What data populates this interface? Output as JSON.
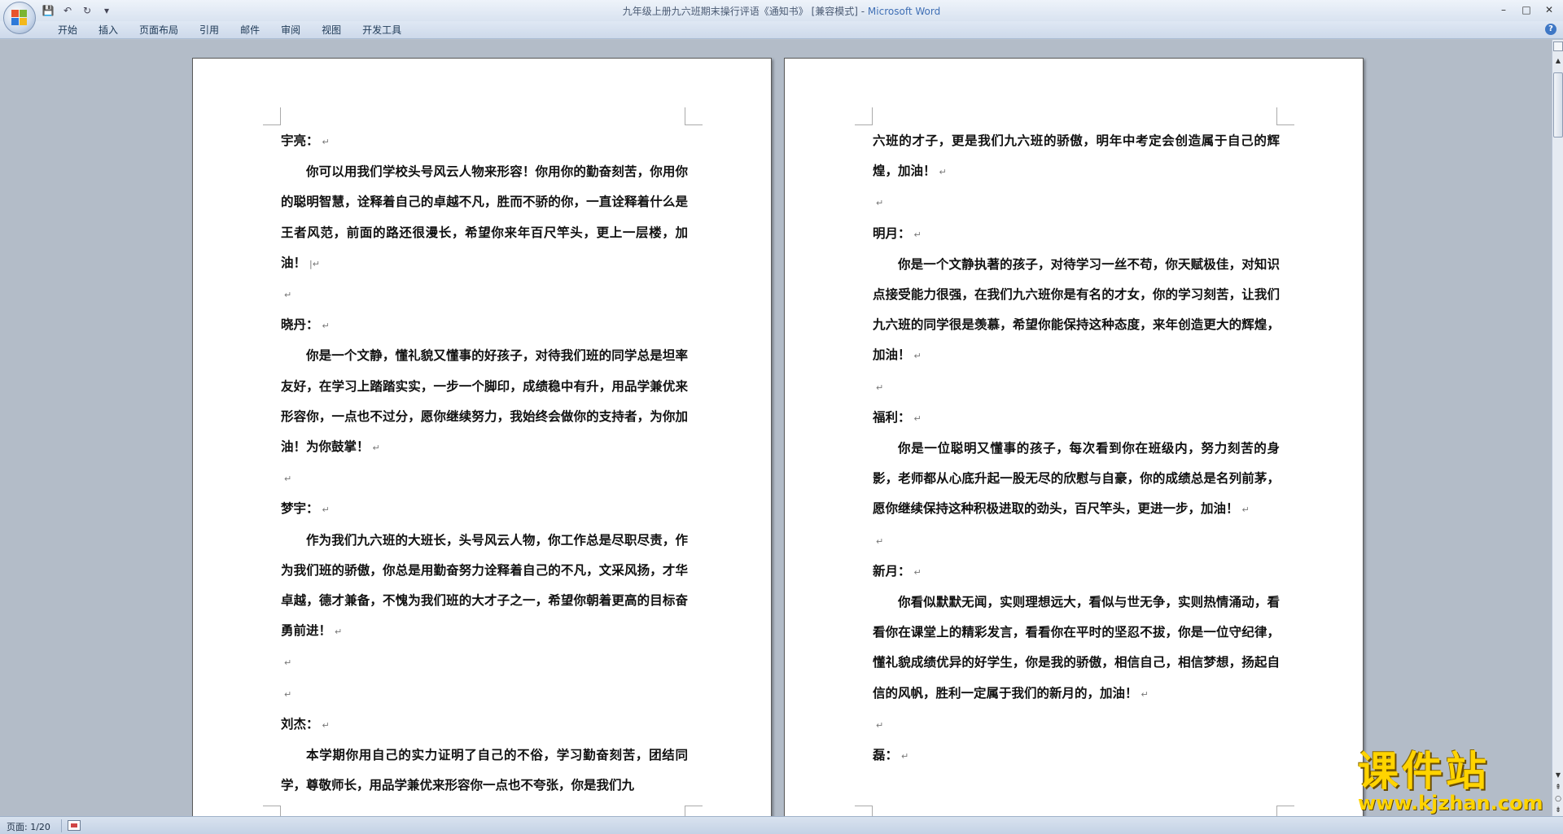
{
  "window": {
    "title_doc": "九年级上册九六班期末操行评语《通知书》 [兼容模式] - ",
    "title_app": "Microsoft Word"
  },
  "qat": {
    "save_icon": "💾",
    "undo_icon": "↶",
    "redo_icon": "↻",
    "customize_icon": "▾"
  },
  "window_controls": {
    "minimize": "–",
    "maximize": "□",
    "close": "✕"
  },
  "ribbon": {
    "tabs": [
      "开始",
      "插入",
      "页面布局",
      "引用",
      "邮件",
      "审阅",
      "视图",
      "开发工具"
    ],
    "help_label": "?"
  },
  "pages": [
    {
      "paragraphs": [
        {
          "text": "宇亮：",
          "indent": false,
          "mark": "↵"
        },
        {
          "text": "你可以用我们学校头号风云人物来形容！你用你的勤奋刻苦，你用你的聪明智慧，诠释着自己的卓越不凡，胜而不骄的你，一直诠释着什么是王者风范，前面的路还很漫长，希望你来年百尺竿头，更上一层楼，加油！",
          "indent": true,
          "mark": "|↵"
        },
        {
          "text": "",
          "indent": false,
          "mark": "↵"
        },
        {
          "text": "晓丹：",
          "indent": false,
          "mark": "↵"
        },
        {
          "text": "你是一个文静，懂礼貌又懂事的好孩子，对待我们班的同学总是坦率友好，在学习上踏踏实实，一步一个脚印，成绩稳中有升，用品学兼优来形容你，一点也不过分，愿你继续努力，我始终会做你的支持者，为你加油！为你鼓掌！",
          "indent": true,
          "mark": "↵"
        },
        {
          "text": "",
          "indent": false,
          "mark": "↵"
        },
        {
          "text": "梦宇：",
          "indent": false,
          "mark": "↵"
        },
        {
          "text": "作为我们九六班的大班长，头号风云人物，你工作总是尽职尽责，作为我们班的骄傲，你总是用勤奋努力诠释着自己的不凡，文采风扬，才华卓越，德才兼备，不愧为我们班的大才子之一，希望你朝着更高的目标奋勇前进！",
          "indent": true,
          "mark": "↵"
        },
        {
          "text": "",
          "indent": false,
          "mark": "↵"
        },
        {
          "text": "",
          "indent": false,
          "mark": "↵"
        },
        {
          "text": "刘杰：",
          "indent": false,
          "mark": "↵"
        },
        {
          "text": "本学期你用自己的实力证明了自己的不俗，学习勤奋刻苦，团结同学，尊敬师长，用品学兼优来形容你一点也不夸张，你是我们九",
          "indent": true,
          "mark": ""
        }
      ]
    },
    {
      "paragraphs": [
        {
          "text": "六班的才子，更是我们九六班的骄傲，明年中考定会创造属于自己的辉煌，加油！",
          "indent": false,
          "mark": "↵"
        },
        {
          "text": "",
          "indent": false,
          "mark": "↵"
        },
        {
          "text": "明月：",
          "indent": false,
          "mark": "↵"
        },
        {
          "text": "你是一个文静执著的孩子，对待学习一丝不苟，你天赋极佳，对知识点接受能力很强，在我们九六班你是有名的才女，你的学习刻苦，让我们九六班的同学很是羡慕，希望你能保持这种态度，来年创造更大的辉煌，加油！",
          "indent": true,
          "mark": "↵"
        },
        {
          "text": "",
          "indent": false,
          "mark": "↵"
        },
        {
          "text": "福利：",
          "indent": false,
          "mark": "↵"
        },
        {
          "text": "你是一位聪明又懂事的孩子，每次看到你在班级内，努力刻苦的身影，老师都从心底升起一股无尽的欣慰与自豪，你的成绩总是名列前茅，愿你继续保持这种积极进取的劲头，百尺竿头，更进一步，加油！",
          "indent": true,
          "mark": "↵"
        },
        {
          "text": "",
          "indent": false,
          "mark": "↵"
        },
        {
          "text": "新月：",
          "indent": false,
          "mark": "↵"
        },
        {
          "text": "你看似默默无闻，实则理想远大，看似与世无争，实则热情涌动，看看你在课堂上的精彩发言，看看你在平时的坚忍不拔，你是一位守纪律，懂礼貌成绩优异的好学生，你是我的骄傲，相信自己，相信梦想，扬起自信的风帆，胜利一定属于我们的新月的，加油！",
          "indent": true,
          "mark": "↵"
        },
        {
          "text": "",
          "indent": false,
          "mark": "↵"
        },
        {
          "text": "磊：",
          "indent": false,
          "mark": "↵"
        }
      ]
    }
  ],
  "status": {
    "page_label": "页面: 1/20"
  },
  "watermark": {
    "cn": "课件站",
    "url": "www.kjzhan.com"
  }
}
